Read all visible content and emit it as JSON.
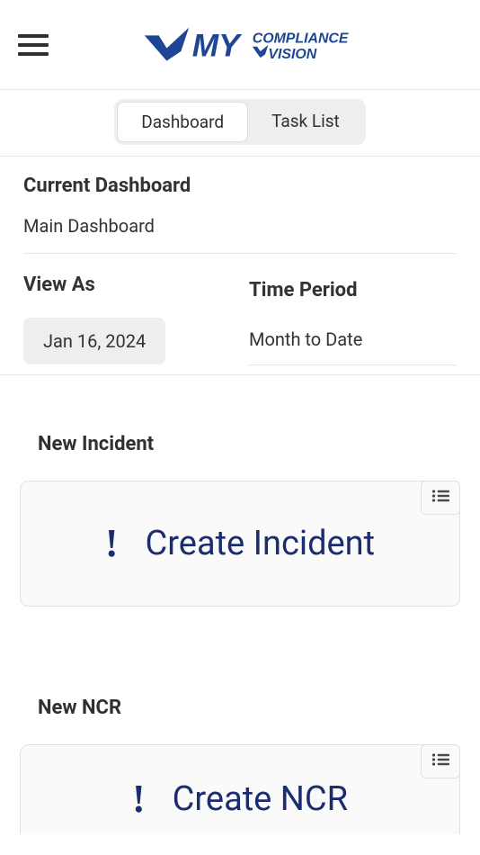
{
  "header": {
    "logo": {
      "brand_my": "MY",
      "brand_compliance": "COMPLIANCE",
      "brand_vision": "VISION"
    }
  },
  "tabs": {
    "dashboard": "Dashboard",
    "tasklist": "Task List"
  },
  "dashboard": {
    "current_label": "Current Dashboard",
    "current_value": "Main Dashboard",
    "viewas_label": "View As",
    "viewas_date": "Jan 16, 2024",
    "timeperiod_label": "Time Period",
    "timeperiod_value": "Month to Date"
  },
  "cards": {
    "incident": {
      "title": "New Incident",
      "action": "Create Incident"
    },
    "ncr": {
      "title": "New NCR",
      "action": "Create NCR"
    }
  }
}
